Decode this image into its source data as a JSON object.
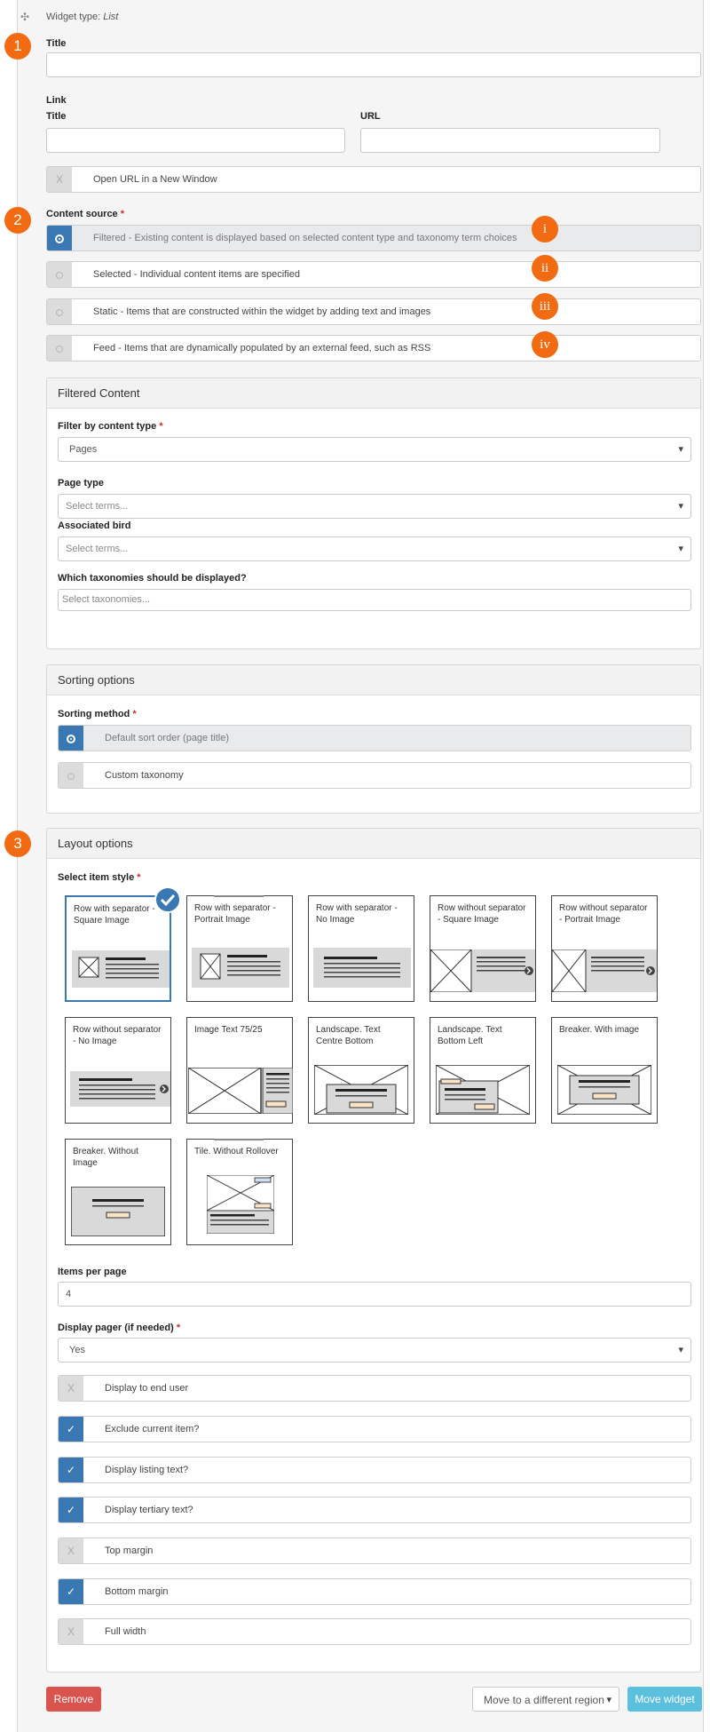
{
  "header": {
    "widget_type_label": "Widget type:",
    "widget_type_value": "List",
    "move_icon": "move-icon"
  },
  "step_badges": [
    "1",
    "2",
    "3"
  ],
  "title_field": {
    "label": "Title",
    "value": ""
  },
  "link": {
    "section_label": "Link",
    "title_label": "Title",
    "title_value": "",
    "url_label": "URL",
    "url_value": "",
    "new_window_toggle": {
      "label": "Open URL in a New Window",
      "checked": false
    }
  },
  "content_source": {
    "label": "Content source",
    "required": "*",
    "options": [
      {
        "label": "Filtered - Existing content is displayed based on selected content type and taxonomy term choices",
        "selected": true,
        "marker": "i"
      },
      {
        "label": "Selected - Individual content items are specified",
        "selected": false,
        "marker": "ii"
      },
      {
        "label": "Static - Items that are constructed within the widget by adding text and images",
        "selected": false,
        "marker": "iii"
      },
      {
        "label": "Feed - Items that are dynamically populated by an external feed, such as RSS",
        "selected": false,
        "marker": "iv"
      }
    ]
  },
  "filtered_content": {
    "heading": "Filtered Content",
    "content_type_label": "Filter by content type",
    "required": "*",
    "content_type_value": "Pages",
    "page_type_label": "Page type",
    "page_type_placeholder": "Select terms...",
    "associated_bird_label": "Associated bird",
    "associated_bird_placeholder": "Select terms...",
    "taxonomies_label": "Which taxonomies should be displayed?",
    "taxonomies_placeholder": "Select taxonomies..."
  },
  "sorting": {
    "heading": "Sorting options",
    "method_label": "Sorting method",
    "required": "*",
    "options": [
      {
        "label": "Default sort order (page title)",
        "selected": true
      },
      {
        "label": "Custom taxonomy",
        "selected": false
      }
    ]
  },
  "layout": {
    "heading": "Layout options",
    "item_style_label": "Select item style",
    "required": "*",
    "styles": [
      {
        "label": "Row with separator - Square Image",
        "selected": true
      },
      {
        "label": "Row with separator - Portrait Image",
        "selected": false
      },
      {
        "label": "Row with separator - No Image",
        "selected": false
      },
      {
        "label": "Row without separator - Square Image",
        "selected": false
      },
      {
        "label": "Row without separator - Portrait Image",
        "selected": false
      },
      {
        "label": "Row without separator - No Image",
        "selected": false
      },
      {
        "label": "Image Text 75/25",
        "selected": false
      },
      {
        "label": "Landscape. Text Centre Bottom",
        "selected": false
      },
      {
        "label": "Landscape. Text Bottom Left",
        "selected": false
      },
      {
        "label": "Breaker. With image",
        "selected": false
      },
      {
        "label": "Breaker. Without Image",
        "selected": false
      },
      {
        "label": "Tile. Without Rollover",
        "selected": false
      }
    ],
    "items_per_page_label": "Items per page",
    "items_per_page_value": "4",
    "display_pager_label": "Display pager (if needed)",
    "display_pager_value": "Yes",
    "checkboxes": [
      {
        "label": "Display to end user",
        "checked": false
      },
      {
        "label": "Exclude current item?",
        "checked": true
      },
      {
        "label": "Display listing text?",
        "checked": true
      },
      {
        "label": "Display tertiary text?",
        "checked": true
      },
      {
        "label": "Top margin",
        "checked": false
      },
      {
        "label": "Bottom margin",
        "checked": true
      },
      {
        "label": "Full width",
        "checked": false
      }
    ]
  },
  "footer": {
    "remove_label": "Remove",
    "move_region_label": "Move to a different region",
    "move_widget_label": "Move widget"
  },
  "glyphs": {
    "check": "✓",
    "cross": "X"
  },
  "colors": {
    "accent_blue": "#3a78b4",
    "badge_orange": "#f26b12",
    "remove_red": "#d9534f",
    "move_blue": "#5bc0de"
  }
}
